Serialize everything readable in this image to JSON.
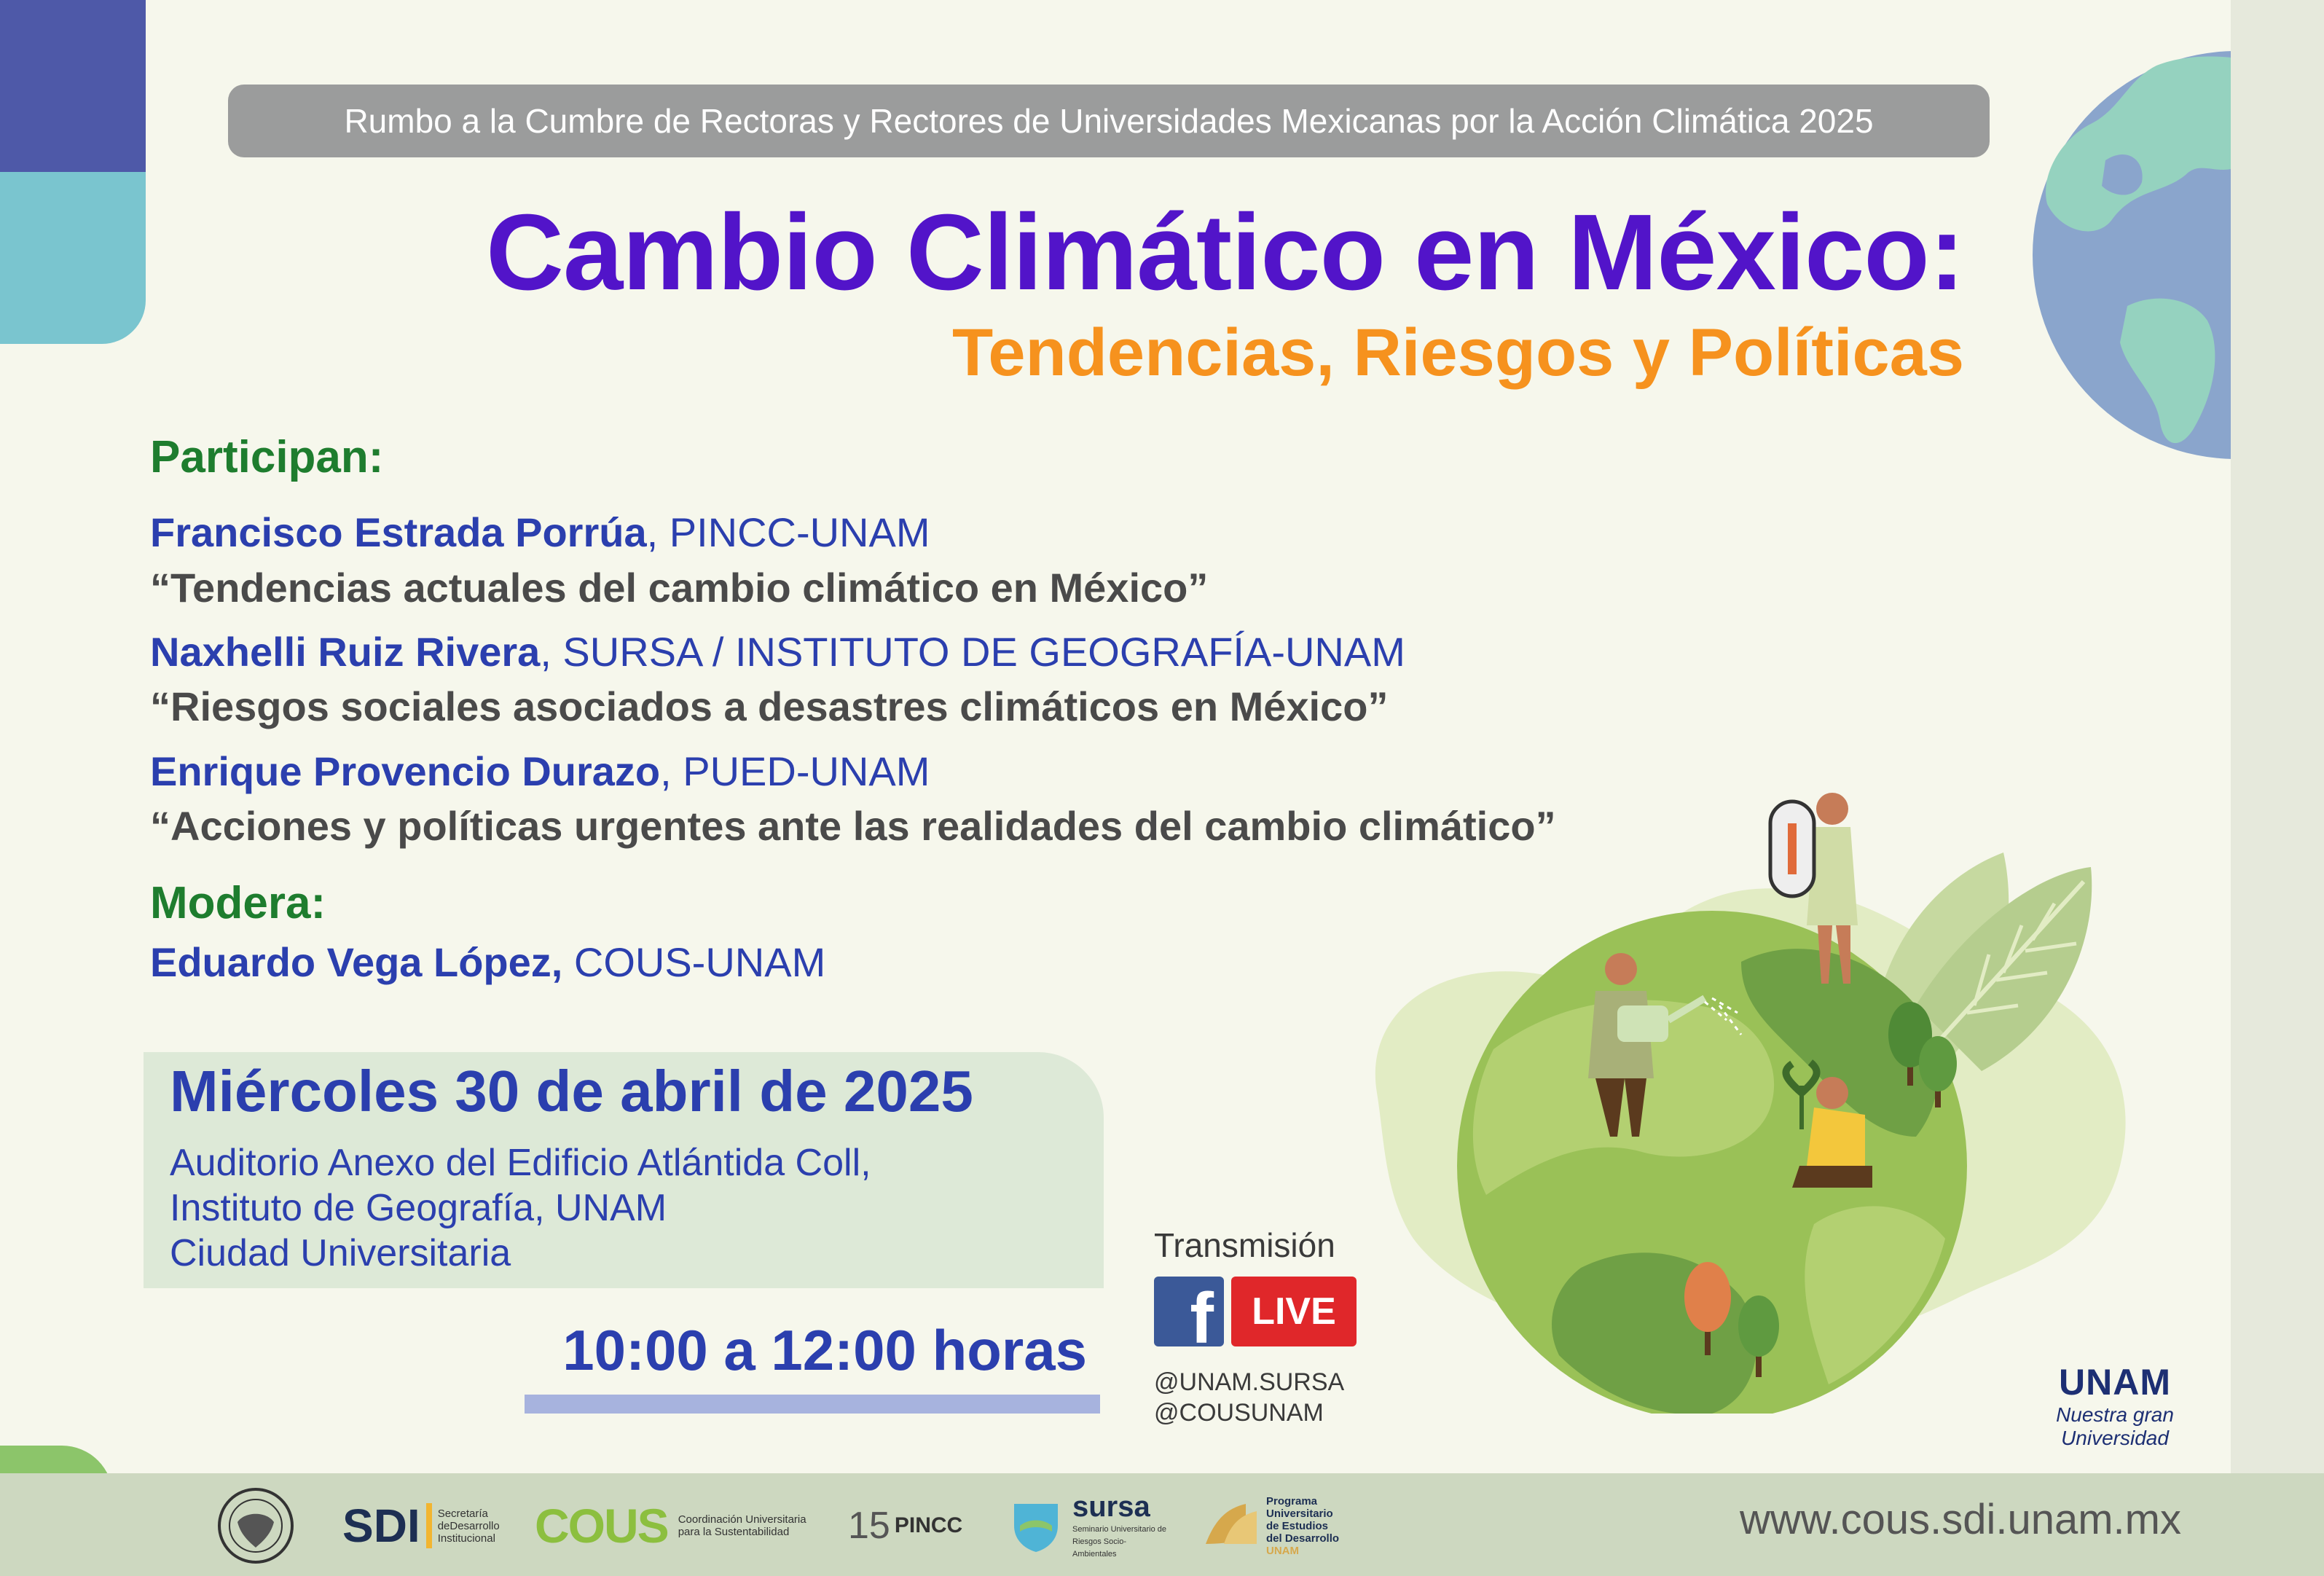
{
  "banner": {
    "text": "Rumbo a la Cumbre de Rectoras y Rectores de Universidades Mexicanas por la Acción Climática 2025"
  },
  "title": {
    "main": "Cambio Climático en México:",
    "subtitle": "Tendencias, Riesgos y Políticas"
  },
  "participants": {
    "label": "Participan:",
    "items": [
      {
        "name": "Francisco Estrada Porrúa",
        "affiliation": ", PINCC-UNAM",
        "talk": "“Tendencias actuales del cambio climático en México”"
      },
      {
        "name": "Naxhelli Ruiz Rivera",
        "affiliation": ", SURSA / INSTITUTO DE GEOGRAFÍA-UNAM",
        "talk": "“Riesgos sociales asociados a desastres climáticos en México”"
      },
      {
        "name": "Enrique Provencio Durazo",
        "affiliation": ", PUED-UNAM",
        "talk": "“Acciones y políticas urgentes ante las realidades del cambio climático”"
      }
    ]
  },
  "moderator": {
    "label": "Modera:",
    "name": "Eduardo Vega López,",
    "affiliation": " COUS-UNAM"
  },
  "event": {
    "date": "Miércoles 30 de abril de 2025",
    "venue_lines": [
      "Auditorio Anexo del Edificio Atlántida Coll,",
      "Instituto de Geografía, UNAM",
      "Ciudad Universitaria"
    ],
    "hours": "10:00 a 12:00 horas"
  },
  "stream": {
    "label": "Transmisión",
    "fb_letter": "f",
    "live": "LIVE",
    "handles": [
      "@UNAM.SURSA",
      "@COUSUNAM"
    ]
  },
  "unam_logo": {
    "word": "UNAM",
    "tag_1": "Nuestra gran",
    "tag_2": "Universidad"
  },
  "footer": {
    "url": "www.cous.sdi.unam.mx",
    "logos": {
      "sdi_mark": "SDI",
      "sdi_text_1": "Secretaría",
      "sdi_text_2": "deDesarrollo",
      "sdi_text_3": "Institucional",
      "cous_mark": "COUS",
      "cous_text_1": "Coordinación Universitaria",
      "cous_text_2": "para la Sustentabilidad",
      "pincc_number": "15",
      "pincc_mark": "PINCC",
      "sursa_mark": "sursa",
      "sursa_text": "Seminario Universitario de Riesgos Socio-Ambientales",
      "pued_text_1": "Programa",
      "pued_text_2": "Universitario",
      "pued_text_3": "de Estudios",
      "pued_text_4": "del Desarrollo",
      "pued_text_5": "UNAM"
    }
  },
  "colors": {
    "title_purple": "#5214c9",
    "subtitle_orange": "#f6921e",
    "label_green": "#1e7d2e",
    "text_blue": "#2b3fae",
    "background": "#f6f7ec"
  }
}
